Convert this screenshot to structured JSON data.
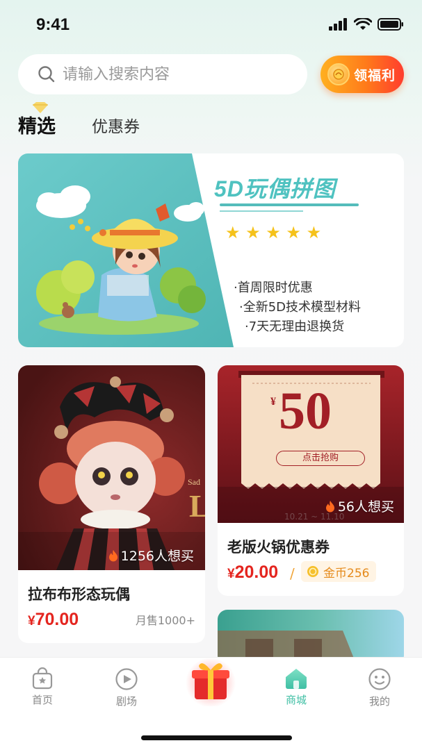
{
  "status_bar": {
    "time": "9:41"
  },
  "search": {
    "placeholder": "请输入搜索内容"
  },
  "welfare_button": {
    "label": "领福利"
  },
  "tabs": [
    {
      "label": "精选",
      "active": true
    },
    {
      "label": "优惠券",
      "active": false
    }
  ],
  "banner": {
    "title": "5D玩偶拼图",
    "stars": "★ ★ ★ ★ ★",
    "star_count": 5,
    "bullets": [
      "·首周限时优惠",
      "·全新5D技术模型材料",
      "·7天无理由退换货"
    ]
  },
  "products": [
    {
      "title": "拉布布形态玩偶",
      "want": "1256人想买",
      "currency": "¥",
      "price": "70.00",
      "monthly_sales": "月售1000+"
    },
    {
      "title": "老版火锅优惠券",
      "want": "56人想买",
      "currency": "¥",
      "price": "20.00",
      "separator": "/",
      "coins": "金币256",
      "coupon": {
        "currency": "¥",
        "amount": "50",
        "action": "点击抢购",
        "dates": "10.21 ~ 11.10"
      }
    }
  ],
  "tab_bar": [
    {
      "label": "首页",
      "icon": "shop-bag-icon",
      "active": false
    },
    {
      "label": "剧场",
      "icon": "play-icon",
      "active": false
    },
    {
      "label": "",
      "icon": "gift-box-icon",
      "active": false
    },
    {
      "label": "商城",
      "icon": "home-icon",
      "active": true
    },
    {
      "label": "我的",
      "icon": "smiley-icon",
      "active": false
    }
  ],
  "colors": {
    "accent": "#3fbfa4",
    "price": "#e4251f",
    "banner_teal": "#4fc2c0",
    "welfare_orange": "#ff7a1a",
    "coupon_red": "#8f1d22"
  }
}
